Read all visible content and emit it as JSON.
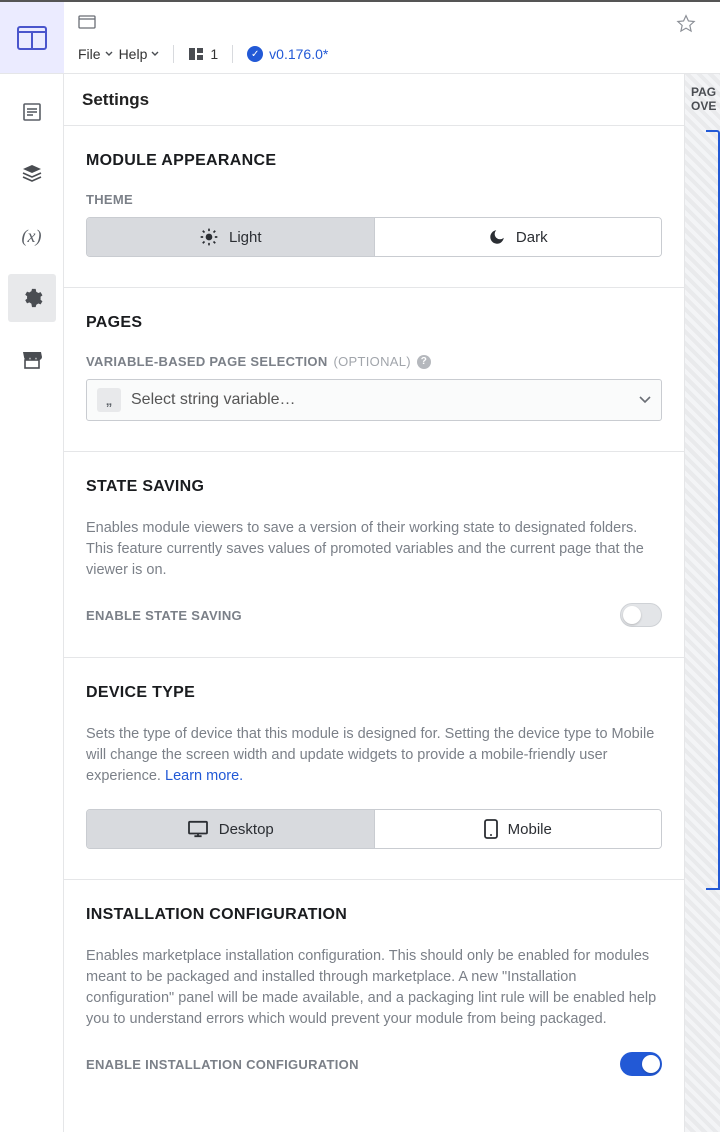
{
  "toolbar": {
    "file": "File",
    "help": "Help",
    "board_count": "1",
    "version": "v0.176.0*"
  },
  "right_stub": "PAG\nOVE",
  "page_title": "Settings",
  "appearance": {
    "title": "MODULE APPEARANCE",
    "theme_label": "THEME",
    "light": "Light",
    "dark": "Dark"
  },
  "pages": {
    "title": "PAGES",
    "vbps_label": "VARIABLE-BASED PAGE SELECTION",
    "optional": "(OPTIONAL)",
    "placeholder": "Select string variable…"
  },
  "state_saving": {
    "title": "STATE SAVING",
    "desc": "Enables module viewers to save a version of their working state to designated folders. This feature currently saves values of promoted variables and the current page that the viewer is on.",
    "enable_label": "ENABLE STATE SAVING"
  },
  "device": {
    "title": "DEVICE TYPE",
    "desc_a": "Sets the type of device that this module is designed for. Setting the device type to Mobile will change the screen width and update widgets to provide a mobile-friendly user experience. ",
    "learn_more": "Learn more.",
    "desktop": "Desktop",
    "mobile": "Mobile"
  },
  "install": {
    "title": "INSTALLATION CONFIGURATION",
    "desc": "Enables marketplace installation configuration. This should only be enabled for modules meant to be packaged and installed through marketplace. A new \"Installation configuration\" panel will be made available, and a packaging lint rule will be enabled help you to understand errors which would prevent your module from being packaged.",
    "enable_label": "ENABLE INSTALLATION CONFIGURATION"
  }
}
